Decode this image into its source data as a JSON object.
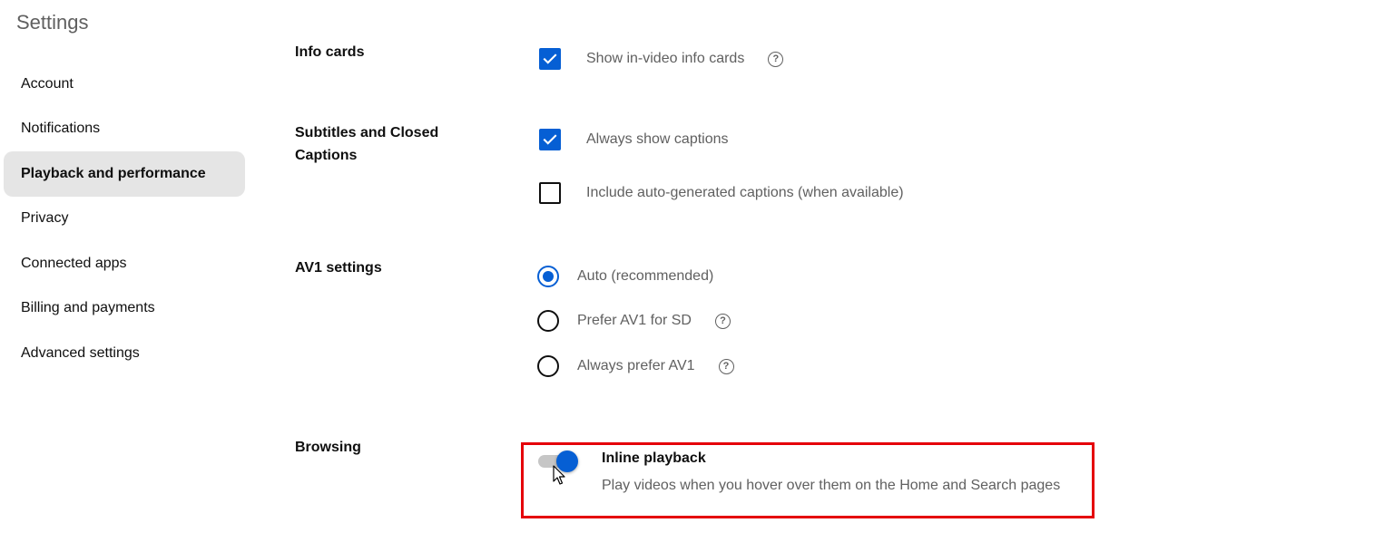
{
  "sidebar": {
    "title": "Settings",
    "items": [
      {
        "label": "Account"
      },
      {
        "label": "Notifications"
      },
      {
        "label": "Playback and performance",
        "active": true
      },
      {
        "label": "Privacy"
      },
      {
        "label": "Connected apps"
      },
      {
        "label": "Billing and payments"
      },
      {
        "label": "Advanced settings"
      }
    ]
  },
  "info_cards": {
    "label": "Info cards",
    "option": {
      "label": "Show in-video info cards",
      "checked": true,
      "help": "?"
    }
  },
  "subtitles": {
    "label": "Subtitles and Closed Captions",
    "options": [
      {
        "label": "Always show captions",
        "checked": true
      },
      {
        "label": "Include auto-generated captions (when available)",
        "checked": false
      }
    ]
  },
  "av1": {
    "label": "AV1 settings",
    "options": [
      {
        "label": "Auto (recommended)",
        "selected": true
      },
      {
        "label": "Prefer AV1 for SD",
        "selected": false,
        "help": "?"
      },
      {
        "label": "Always prefer AV1",
        "selected": false,
        "help": "?"
      }
    ]
  },
  "browsing": {
    "label": "Browsing",
    "inline_playback": {
      "title": "Inline playback",
      "description": "Play videos when you hover over them on the Home and Search pages",
      "enabled": true
    }
  },
  "colors": {
    "accent": "#065fd4",
    "highlight_border": "#e5000a",
    "active_nav_bg": "#e5e5e5"
  },
  "icons": [
    "check-icon",
    "help-icon",
    "mouse-cursor-icon"
  ]
}
